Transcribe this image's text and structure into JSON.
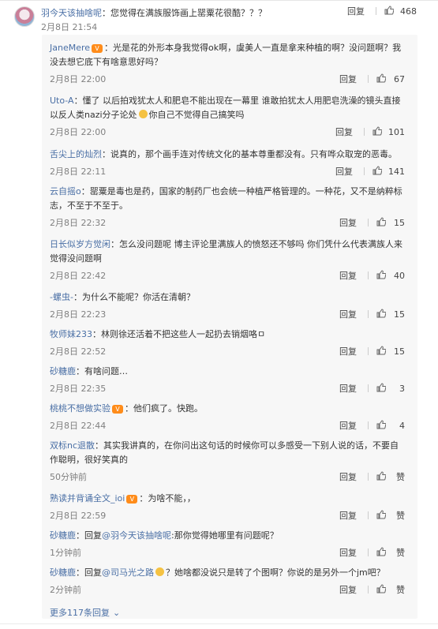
{
  "main_comment": {
    "username": "羽今天该抽啥呢",
    "text": "：您觉得在满族服饰画上罂粟花很酷？？？",
    "time": "2月8日 21:54",
    "reply_label": "回复",
    "likes": "468"
  },
  "replies": [
    {
      "user": "JaneMere",
      "badge": true,
      "text": "：光是花的外形本身我觉得ok啊，虞美人一直是拿来种植的啊？没问题啊？我没去想它底下有啥意思好吗？",
      "time": "2月8日 22:00",
      "likes": "67"
    },
    {
      "user": "Uto-A",
      "text_before": "：懂了 以后拍戏犹太人和肥皂不能出现在一幕里 谁敢拍犹太人用肥皂洗澡的镜头直接以反人类nazi分子论处",
      "text_after": "你自己不觉得自己搞笑吗",
      "time": "2月8日 22:00",
      "likes": "101"
    },
    {
      "user": "舌尖上的灿烈",
      "text": "：说真的，那个画手连对传统文化的基本尊重都没有。只有哗众取宠的恶毒。",
      "time": "2月8日 22:11",
      "likes": "141"
    },
    {
      "user": "云自摇o",
      "text": "：罂粟是毒也是药，国家的制药厂也会统一种植严格管理的。一种花，又不是纳粹标志，不至于不至于。",
      "time": "2月8日 22:32",
      "likes": "15"
    },
    {
      "user": "日长似岁方觉闲",
      "text": "：怎么没问题呢 博主评论里满族人的愤怒还不够吗 你们凭什么代表满族人来觉得没问题啊",
      "time": "2月8日 22:42",
      "likes": "40"
    },
    {
      "user": "-螺虫-",
      "text": "：为什么不能呢？你活在清朝？",
      "time": "2月8日 22:23",
      "likes": "15"
    },
    {
      "user": "牧师妹233",
      "text": "：林则徐还活着不把这些人一起扔去销烟咯ㅁ",
      "time": "2月8日 22:52",
      "likes": "15"
    },
    {
      "user": "砂糖鹿",
      "text": "：有啥问题…",
      "time": "2月8日 22:35",
      "likes": "3"
    },
    {
      "user": "桃桃不想做实验",
      "badge": true,
      "text": "：他们疯了。快跑。",
      "time": "2月8日 22:44",
      "likes": "4"
    },
    {
      "user": "双标nc退散",
      "text": "：其实我讲真的，在你问出这句话的时候你可以多感受一下别人说的话，不要自作聪明，很好笑真的",
      "time": "50分钟前",
      "likes": "赞"
    },
    {
      "user": "熟读并背诵全文_ioi",
      "badge": true,
      "text": "：为啥不能，，",
      "time": "2月8日 22:59",
      "likes": "赞"
    },
    {
      "user": "砂糖鹿",
      "text_pre": "：回复",
      "mention": "@羽今天该抽啥呢",
      "text": ":那你觉得她哪里有问题呢？",
      "time": "1分钟前",
      "likes": "赞"
    },
    {
      "user": "砂糖鹿",
      "text_pre": "：回复",
      "mention": "@司马光之路",
      "emoji": true,
      "text": "？她啥都没说只是转了个图啊？你说的是另外一个jm吧？",
      "time": "2分钟前",
      "likes": "赞"
    }
  ],
  "reply_label": "回复",
  "more_replies": "更多117条回复",
  "colors": {
    "username": "#eb7350",
    "link": "#4a6fa5",
    "badge": "#ff8c1a",
    "time": "#808080"
  }
}
